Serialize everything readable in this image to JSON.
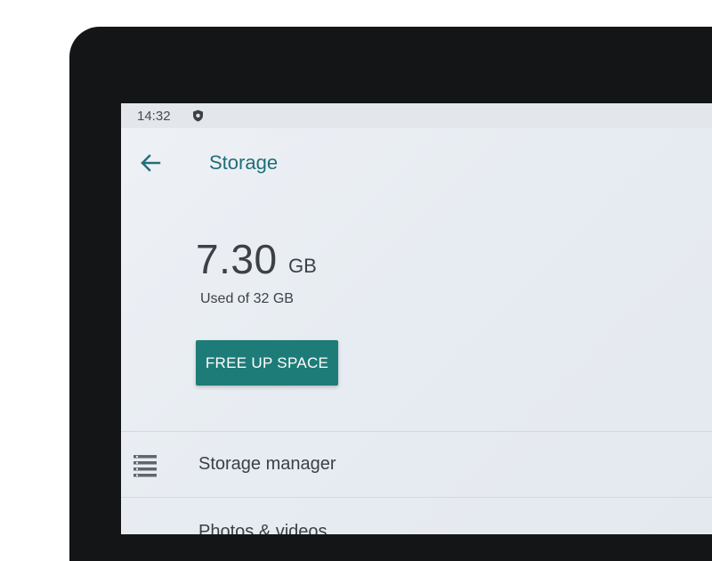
{
  "status_bar": {
    "time": "14:32",
    "icon": "shield-icon"
  },
  "header": {
    "back_icon": "arrow-left-icon",
    "title": "Storage"
  },
  "summary": {
    "used_value": "7.30",
    "used_unit": "GB",
    "used_of": "Used of 32 GB",
    "used_fraction": 0.228
  },
  "actions": {
    "free_up_label": "FREE UP SPACE"
  },
  "list": {
    "items": [
      {
        "label": "Storage manager",
        "icon": "storage-manager-icon"
      },
      {
        "label": "Photos & videos",
        "icon": "photos-icon"
      }
    ]
  },
  "colors": {
    "accent": "#1e7c78",
    "title": "#1f6f78",
    "bezel": "#141516"
  }
}
